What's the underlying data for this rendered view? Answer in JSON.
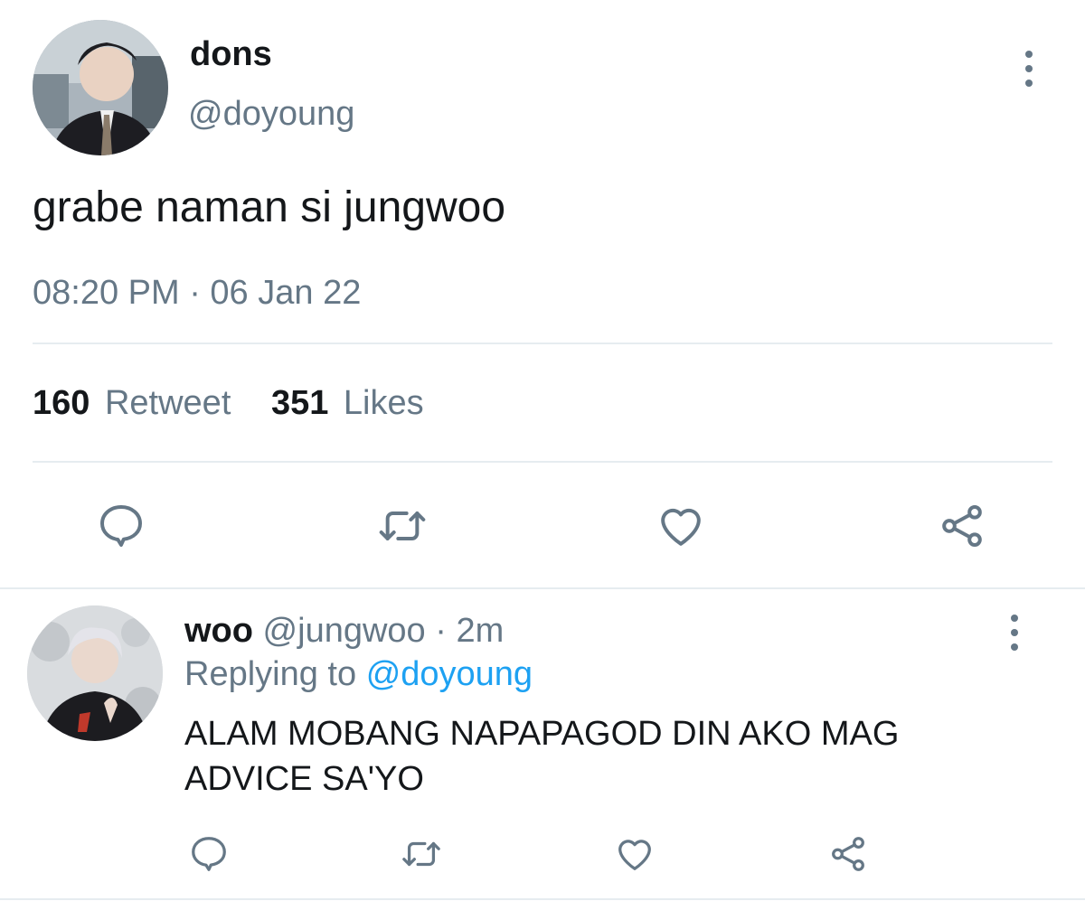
{
  "tweet": {
    "author_name": "dons",
    "author_handle": "@doyoung",
    "text": "grabe naman si jungwoo",
    "timestamp": "08:20 PM · 06 Jan 22",
    "retweet_count": "160",
    "retweet_label": "Retweet",
    "likes_count": "351",
    "likes_label": "Likes",
    "actions": [
      "reply-icon",
      "retweet-icon",
      "like-icon",
      "share-icon"
    ]
  },
  "reply": {
    "author_name": "woo",
    "author_handle": "@jungwoo",
    "time_sep": "·",
    "time": "2m",
    "replying_prefix": "Replying to",
    "replying_handle": "@doyoung",
    "text_line1": "ALAM MOBANG NAPAPAGOD DIN AKO MAG",
    "text_line2": "ADVICE SA'YO",
    "actions": [
      "reply-icon",
      "retweet-icon",
      "like-icon",
      "share-icon"
    ]
  },
  "colors": {
    "text_primary": "#14171a",
    "text_secondary": "#657786",
    "link": "#1da1f2",
    "divider": "#e6ecf0"
  }
}
